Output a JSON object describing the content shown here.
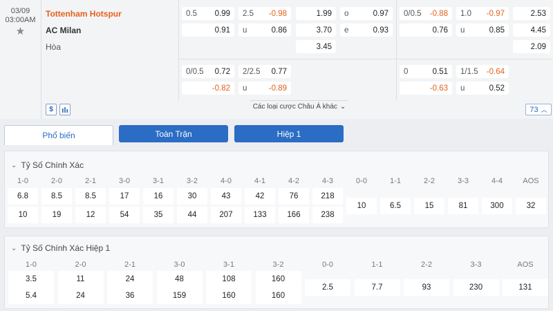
{
  "match": {
    "date": "03/09",
    "time": "03:00AM",
    "home": "Tottenham Hotspur",
    "away": "AC Milan",
    "draw_label": "Hòa"
  },
  "odds_main": {
    "hdp_line": "0.5",
    "hdp_home": "0.99",
    "hdp_away": "0.91",
    "ou_line": "2.5",
    "ou_over": "-0.98",
    "ou_u_label": "u",
    "ou_under": "0.86",
    "x12_home": "1.99",
    "x12_away": "3.70",
    "x12_draw": "3.45",
    "oe_o_label": "o",
    "oe_odd": "0.97",
    "oe_e_label": "e",
    "oe_even": "0.93",
    "h1_hdp_line": "0/0.5",
    "h1_hdp_home": "-0.88",
    "h1_hdp_away": "0.76",
    "h1_ou_line": "1.0",
    "h1_ou_over": "-0.97",
    "h1_ou_u_label": "u",
    "h1_ou_under": "0.85",
    "h1_x12_home": "2.53",
    "h1_x12_away": "4.45",
    "h1_x12_draw": "2.09"
  },
  "odds_alt": {
    "hdp_line": "0/0.5",
    "hdp_home": "0.72",
    "hdp_away": "-0.82",
    "ou_line": "2/2.5",
    "ou_over": "0.77",
    "ou_u_label": "u",
    "ou_under": "-0.89",
    "h1_hdp_line": "0",
    "h1_hdp_home": "0.51",
    "h1_hdp_away": "-0.63",
    "h1_ou_line": "1/1.5",
    "h1_ou_over": "-0.64",
    "h1_ou_u_label": "u",
    "h1_ou_under": "0.52"
  },
  "controls": {
    "dollar_icon_text": "$",
    "more_bets_label": "Các loại cược Châu Á khác",
    "more_count": "73"
  },
  "tabs": [
    "Phổ biến",
    "Toàn Trận",
    "Hiệp 1"
  ],
  "correct_score": {
    "title": "Tỷ Số Chính Xác",
    "home_headers": [
      "1-0",
      "2-0",
      "2-1",
      "3-0",
      "3-1",
      "3-2",
      "4-0",
      "4-1",
      "4-2",
      "4-3"
    ],
    "home_row1": [
      "6.8",
      "8.5",
      "8.5",
      "17",
      "16",
      "30",
      "43",
      "42",
      "76",
      "218"
    ],
    "home_row2": [
      "10",
      "19",
      "12",
      "54",
      "35",
      "44",
      "207",
      "133",
      "166",
      "238"
    ],
    "draw_headers": [
      "0-0",
      "1-1",
      "2-2",
      "3-3",
      "4-4",
      "AOS"
    ],
    "draw_values": [
      "10",
      "6.5",
      "15",
      "81",
      "300",
      "32"
    ]
  },
  "correct_score_h1": {
    "title": "Tỷ Số Chính Xác Hiệp 1",
    "home_headers": [
      "1-0",
      "2-0",
      "2-1",
      "3-0",
      "3-1",
      "3-2"
    ],
    "home_row1": [
      "3.5",
      "11",
      "24",
      "48",
      "108",
      "160"
    ],
    "home_row2": [
      "5.4",
      "24",
      "36",
      "159",
      "160",
      "160"
    ],
    "draw_headers": [
      "0-0",
      "1-1",
      "2-2",
      "3-3",
      "AOS"
    ],
    "draw_values": [
      "2.5",
      "7.7",
      "93",
      "230",
      "131"
    ]
  },
  "colors": {
    "accent": "#2b6cc4",
    "negative": "#e4611c",
    "home_team": "#e4611c"
  }
}
